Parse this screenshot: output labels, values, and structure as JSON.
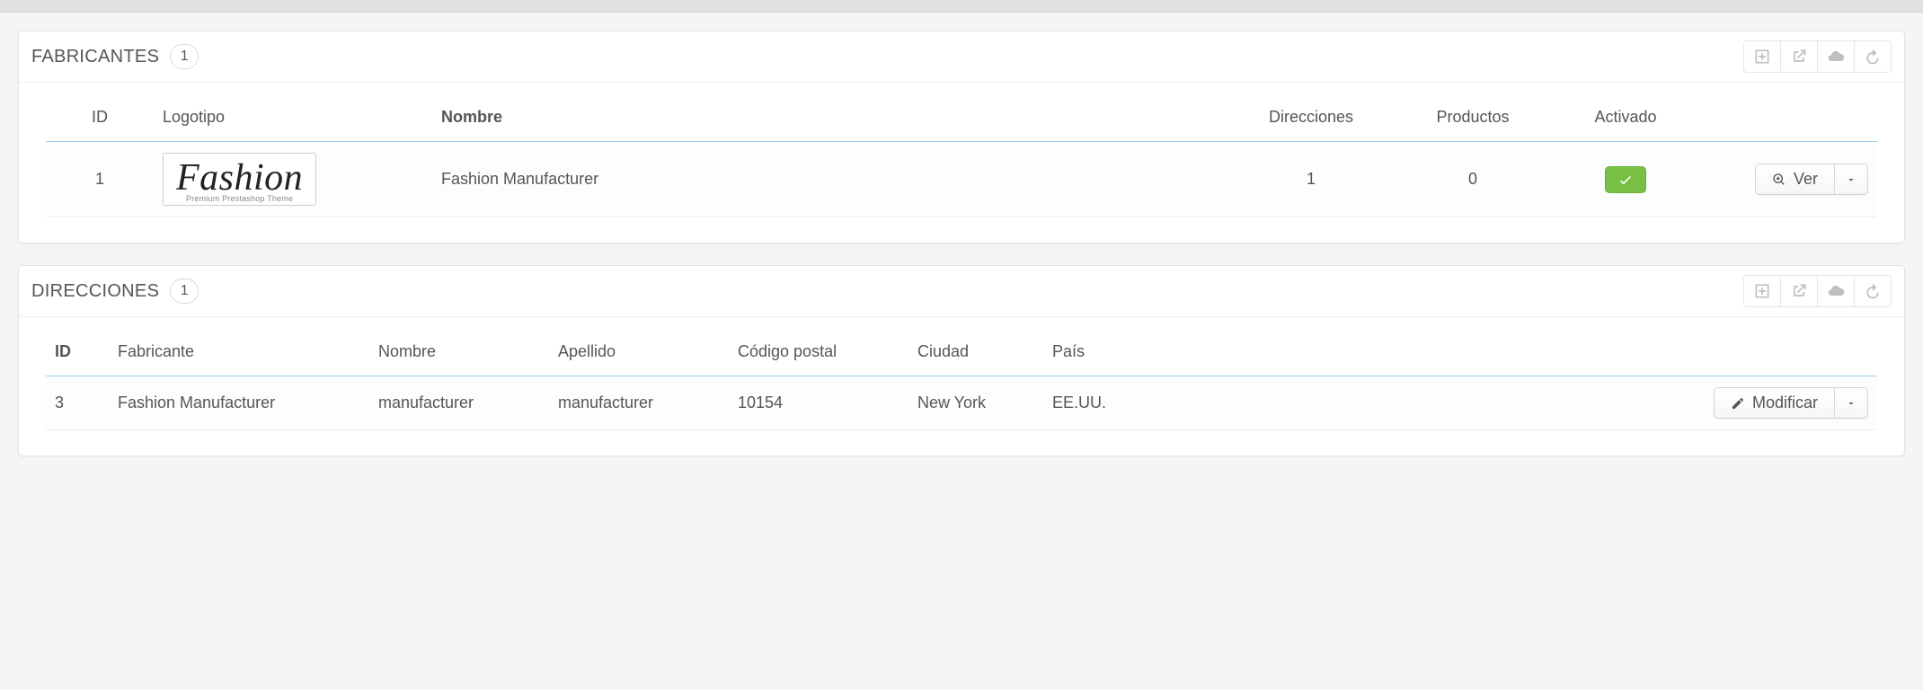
{
  "panels": {
    "manufacturers": {
      "title": "FABRICANTES",
      "count": "1",
      "columns": {
        "id": "ID",
        "logo": "Logotipo",
        "name": "Nombre",
        "addresses": "Direcciones",
        "products": "Productos",
        "active": "Activado"
      },
      "row": {
        "id": "1",
        "logo_text": "Fashion",
        "logo_sub": "Premium Prestashop Theme",
        "name": "Fashion Manufacturer",
        "addresses": "1",
        "products": "0",
        "action_label": "Ver"
      }
    },
    "addresses": {
      "title": "DIRECCIONES",
      "count": "1",
      "columns": {
        "id": "ID",
        "manufacturer": "Fabricante",
        "firstname": "Nombre",
        "lastname": "Apellido",
        "postcode": "Código postal",
        "city": "Ciudad",
        "country": "País"
      },
      "row": {
        "id": "3",
        "manufacturer": "Fashion Manufacturer",
        "firstname": "manufacturer",
        "lastname": "manufacturer",
        "postcode": "10154",
        "city": "New York",
        "country": "EE.UU.",
        "action_label": "Modificar"
      }
    }
  }
}
